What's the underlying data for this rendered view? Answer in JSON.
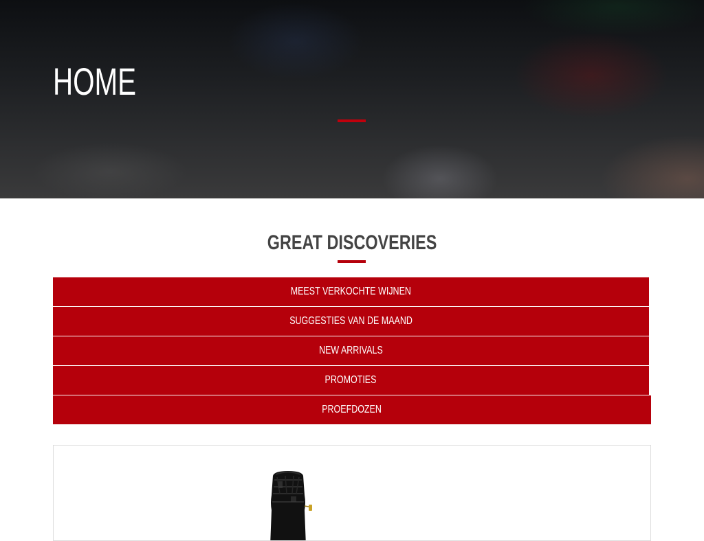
{
  "hero": {
    "title": "HOME"
  },
  "section": {
    "title": "GREAT DISCOVERIES"
  },
  "categories": [
    {
      "label": "MEEST VERKOCHTE WIJNEN"
    },
    {
      "label": "SUGGESTIES VAN DE MAAND"
    },
    {
      "label": "NEW ARRIVALS"
    },
    {
      "label": "PROMOTIES"
    },
    {
      "label": "PROEFDOZEN"
    }
  ],
  "colors": {
    "accent": "#b5000b",
    "heading": "#444444",
    "hero_text": "#ffffff"
  },
  "product": {
    "image": "wine-bottle-icon"
  }
}
